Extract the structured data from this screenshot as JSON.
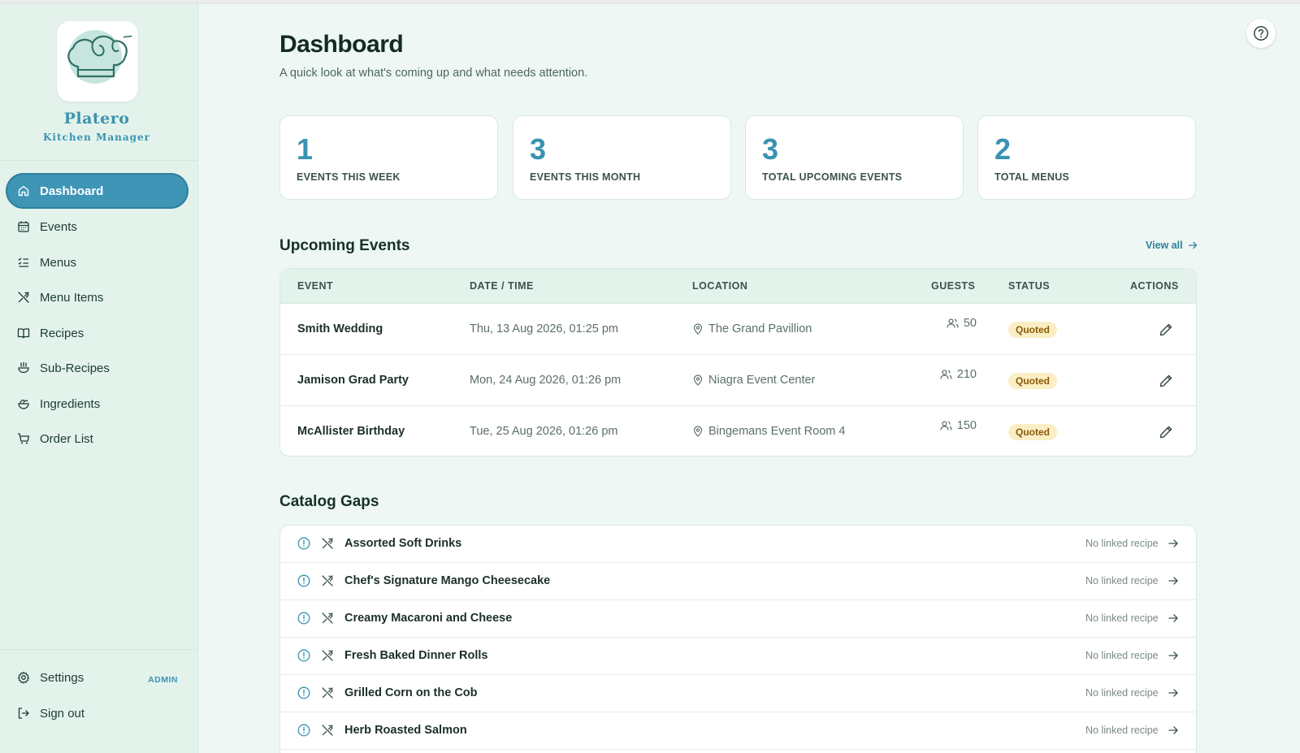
{
  "app": {
    "name": "Platero",
    "subtitle": "Kitchen Manager"
  },
  "sidebar": {
    "items": [
      {
        "label": "Dashboard",
        "icon": "home-icon",
        "active": true
      },
      {
        "label": "Events",
        "icon": "calendar-icon"
      },
      {
        "label": "Menus",
        "icon": "checklist-icon"
      },
      {
        "label": "Menu Items",
        "icon": "utensils-icon"
      },
      {
        "label": "Recipes",
        "icon": "book-icon"
      },
      {
        "label": "Sub-Recipes",
        "icon": "bowl-icon"
      },
      {
        "label": "Ingredients",
        "icon": "salad-icon"
      },
      {
        "label": "Order List",
        "icon": "cart-icon"
      }
    ],
    "settings_label": "Settings",
    "admin_badge": "ADMIN",
    "signout_label": "Sign out"
  },
  "header": {
    "title": "Dashboard",
    "subtitle": "A quick look at what's coming up and what needs attention."
  },
  "stats": [
    {
      "value": "1",
      "label": "EVENTS THIS WEEK"
    },
    {
      "value": "3",
      "label": "EVENTS THIS MONTH"
    },
    {
      "value": "3",
      "label": "TOTAL UPCOMING EVENTS"
    },
    {
      "value": "2",
      "label": "TOTAL MENUS"
    }
  ],
  "upcoming": {
    "title": "Upcoming Events",
    "view_all": "View all",
    "columns": {
      "event": "EVENT",
      "date": "DATE / TIME",
      "location": "LOCATION",
      "guests": "GUESTS",
      "status": "STATUS",
      "actions": "ACTIONS"
    },
    "rows": [
      {
        "event": "Smith Wedding",
        "date": "Thu, 13 Aug 2026, 01:25 pm",
        "location": "The Grand Pavillion",
        "guests": "50",
        "status": "Quoted"
      },
      {
        "event": "Jamison Grad Party",
        "date": "Mon, 24 Aug 2026, 01:26 pm",
        "location": "Niagra Event Center",
        "guests": "210",
        "status": "Quoted"
      },
      {
        "event": "McAllister Birthday",
        "date": "Tue, 25 Aug 2026, 01:26 pm",
        "location": "Bingemans Event Room 4",
        "guests": "150",
        "status": "Quoted"
      }
    ]
  },
  "catalog": {
    "title": "Catalog Gaps",
    "items": [
      {
        "name": "Assorted Soft Drinks",
        "status": "No linked recipe"
      },
      {
        "name": "Chef's Signature Mango Cheesecake",
        "status": "No linked recipe"
      },
      {
        "name": "Creamy Macaroni and Cheese",
        "status": "No linked recipe"
      },
      {
        "name": "Fresh Baked Dinner Rolls",
        "status": "No linked recipe"
      },
      {
        "name": "Grilled Corn on the Cob",
        "status": "No linked recipe"
      },
      {
        "name": "Herb Roasted Salmon",
        "status": "No linked recipe"
      }
    ]
  },
  "colors": {
    "accent": "#3f95b6",
    "sidebar_bg": "#e3f3ec",
    "page_bg": "#eef7f3",
    "status_quoted_bg": "#fbeec4",
    "status_quoted_text": "#8a5a09"
  }
}
